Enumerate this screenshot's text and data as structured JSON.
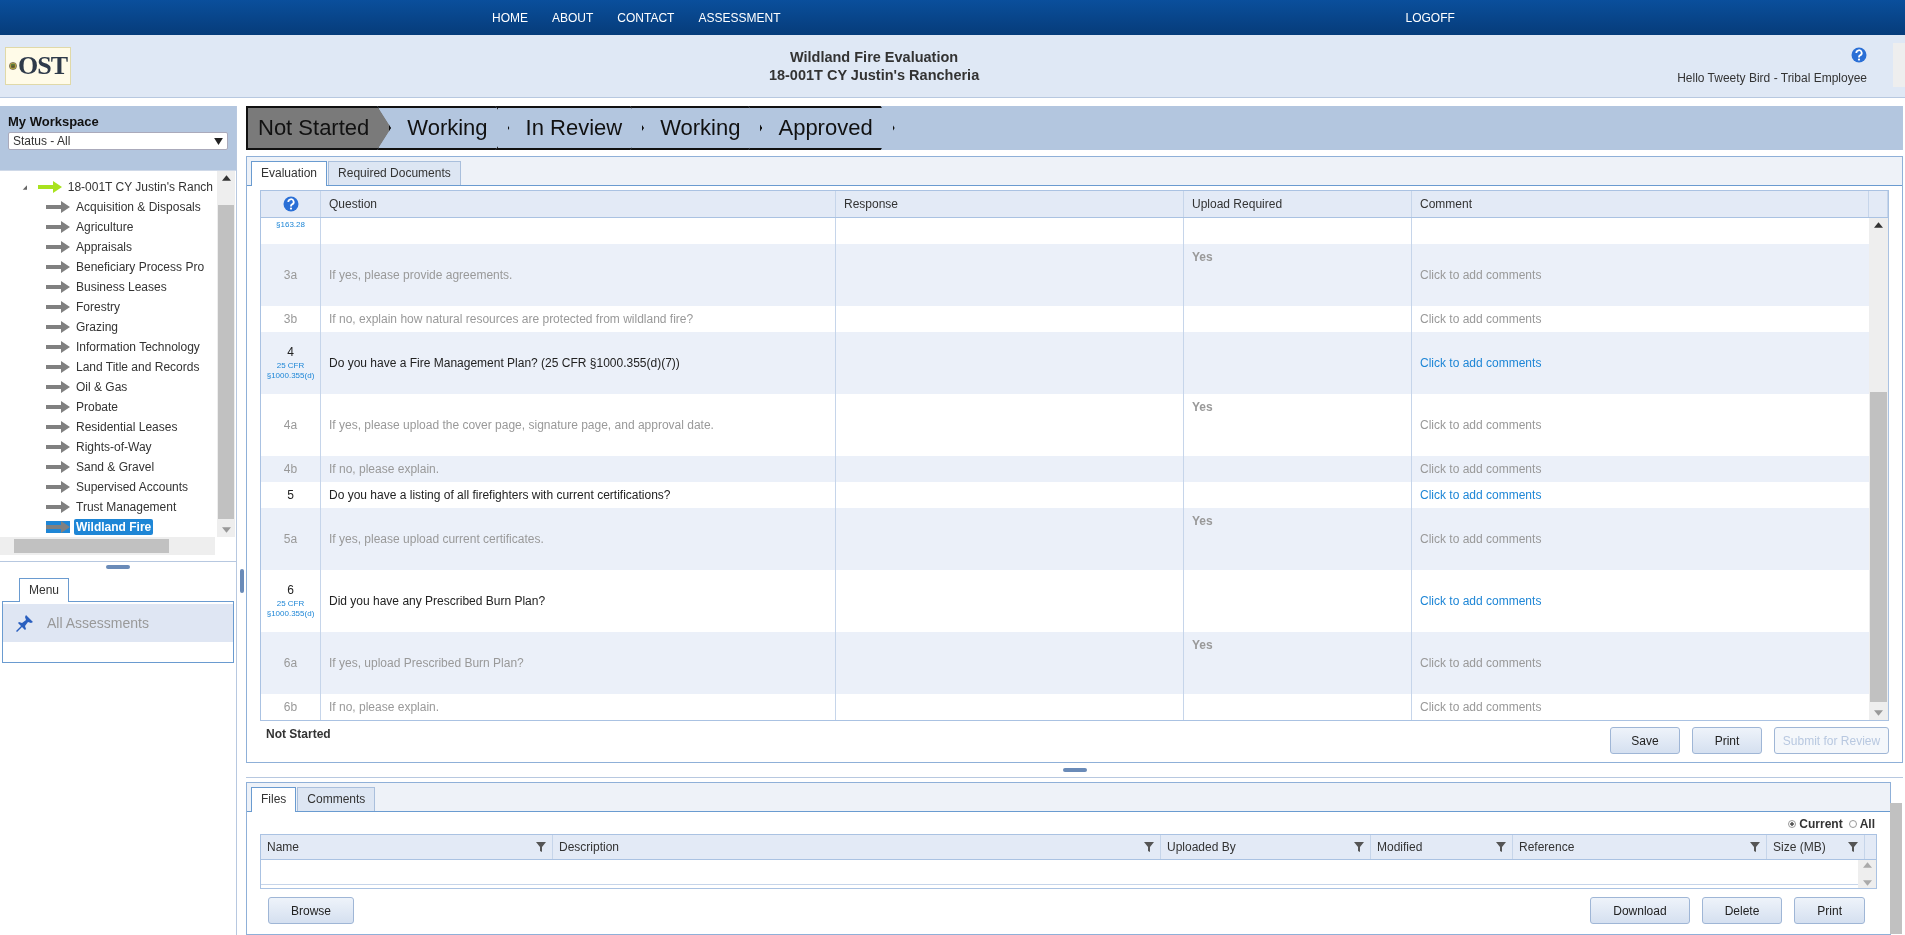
{
  "nav": {
    "items": [
      "HOME",
      "ABOUT",
      "CONTACT",
      "ASSESSMENT"
    ],
    "logoff": "LOGOFF"
  },
  "header": {
    "logo_text": "OST",
    "title": "Wildland Fire Evaluation",
    "subtitle": "18-001T CY Justin's Rancheria",
    "greeting": "Hello Tweety Bird - Tribal Employee"
  },
  "workspace": {
    "title": "My Workspace",
    "status_filter": "Status - All",
    "tree": {
      "label": "18-001T CY Justin's Ranch",
      "expanded": true,
      "children": [
        {
          "label": "Acquisition & Disposals",
          "selected": false
        },
        {
          "label": "Agriculture",
          "selected": false
        },
        {
          "label": "Appraisals",
          "selected": false
        },
        {
          "label": "Beneficiary Process Pro",
          "selected": false
        },
        {
          "label": "Business Leases",
          "selected": false
        },
        {
          "label": "Forestry",
          "selected": false
        },
        {
          "label": "Grazing",
          "selected": false
        },
        {
          "label": "Information Technology",
          "selected": false
        },
        {
          "label": "Land Title and Records",
          "selected": false
        },
        {
          "label": "Oil & Gas",
          "selected": false
        },
        {
          "label": "Probate",
          "selected": false
        },
        {
          "label": "Residential Leases",
          "selected": false
        },
        {
          "label": "Rights-of-Way",
          "selected": false
        },
        {
          "label": "Sand & Gravel",
          "selected": false
        },
        {
          "label": "Supervised Accounts",
          "selected": false
        },
        {
          "label": "Trust Management",
          "selected": false
        },
        {
          "label": "Wildland Fire",
          "selected": true
        }
      ]
    }
  },
  "menu": {
    "tab": "Menu",
    "items": [
      {
        "label": "All Assessments",
        "disabled": true
      }
    ]
  },
  "progress": [
    {
      "label": "Not Started",
      "selected": true
    },
    {
      "label": "Working",
      "selected": false
    },
    {
      "label": "In Review",
      "selected": false
    },
    {
      "label": "Working",
      "selected": false
    },
    {
      "label": "Approved",
      "selected": false
    }
  ],
  "evaluation": {
    "tabs": [
      {
        "label": "Evaluation",
        "selected": true
      },
      {
        "label": "Required Documents",
        "selected": false
      }
    ],
    "columns": [
      "Question",
      "Response",
      "Upload Required",
      "Comment"
    ],
    "rows": [
      {
        "kind": "cut",
        "cfr": "§163.28"
      },
      {
        "kind": "sub",
        "number": "3a",
        "question": "If yes, please provide agreements.",
        "upload": "Yes",
        "comment": "Click to add comments"
      },
      {
        "kind": "sub",
        "number": "3b",
        "question": "If no, explain how natural resources are protected from wildland fire?",
        "comment": "Click to add comments"
      },
      {
        "kind": "main",
        "number": "4",
        "cfr": "25 CFR §1000.355(d)",
        "question": "Do you have a Fire Management Plan? (25 CFR §1000.355(d)(7))",
        "comment": "Click to add comments"
      },
      {
        "kind": "sub",
        "number": "4a",
        "question": "If yes, please upload the cover page, signature page, and approval date.",
        "upload": "Yes",
        "comment": "Click to add comments"
      },
      {
        "kind": "sub",
        "number": "4b",
        "question": "If no, please explain.",
        "comment": "Click to add comments"
      },
      {
        "kind": "main",
        "number": "5",
        "question": "Do you have a listing of all firefighters with current certifications?",
        "comment": "Click to add comments"
      },
      {
        "kind": "sub",
        "number": "5a",
        "question": "If yes, please upload current certificates.",
        "upload": "Yes",
        "comment": "Click to add comments"
      },
      {
        "kind": "main",
        "number": "6",
        "cfr": "25 CFR §1000.355(d)",
        "question": "Did you have any Prescribed Burn Plan?",
        "comment": "Click to add comments"
      },
      {
        "kind": "sub",
        "number": "6a",
        "question": "If yes, upload Prescribed Burn Plan?",
        "upload": "Yes",
        "comment": "Click to add comments"
      },
      {
        "kind": "sub",
        "number": "6b",
        "question": "If no, please explain.",
        "comment": "Click to add comments"
      }
    ],
    "status": "Not Started",
    "buttons": [
      {
        "label": "Save",
        "disabled": false
      },
      {
        "label": "Print",
        "disabled": false
      },
      {
        "label": "Submit for Review",
        "disabled": true
      }
    ]
  },
  "files": {
    "tabs": [
      {
        "label": "Files",
        "selected": true
      },
      {
        "label": "Comments",
        "selected": false
      }
    ],
    "scope": [
      {
        "label": "Current",
        "selected": true
      },
      {
        "label": "All",
        "selected": false
      }
    ],
    "columns": [
      "Name",
      "Description",
      "Uploaded By",
      "Modified",
      "Reference",
      "Size (MB)"
    ],
    "left_button": "Browse",
    "buttons": [
      "Download",
      "Delete",
      "Print"
    ]
  }
}
